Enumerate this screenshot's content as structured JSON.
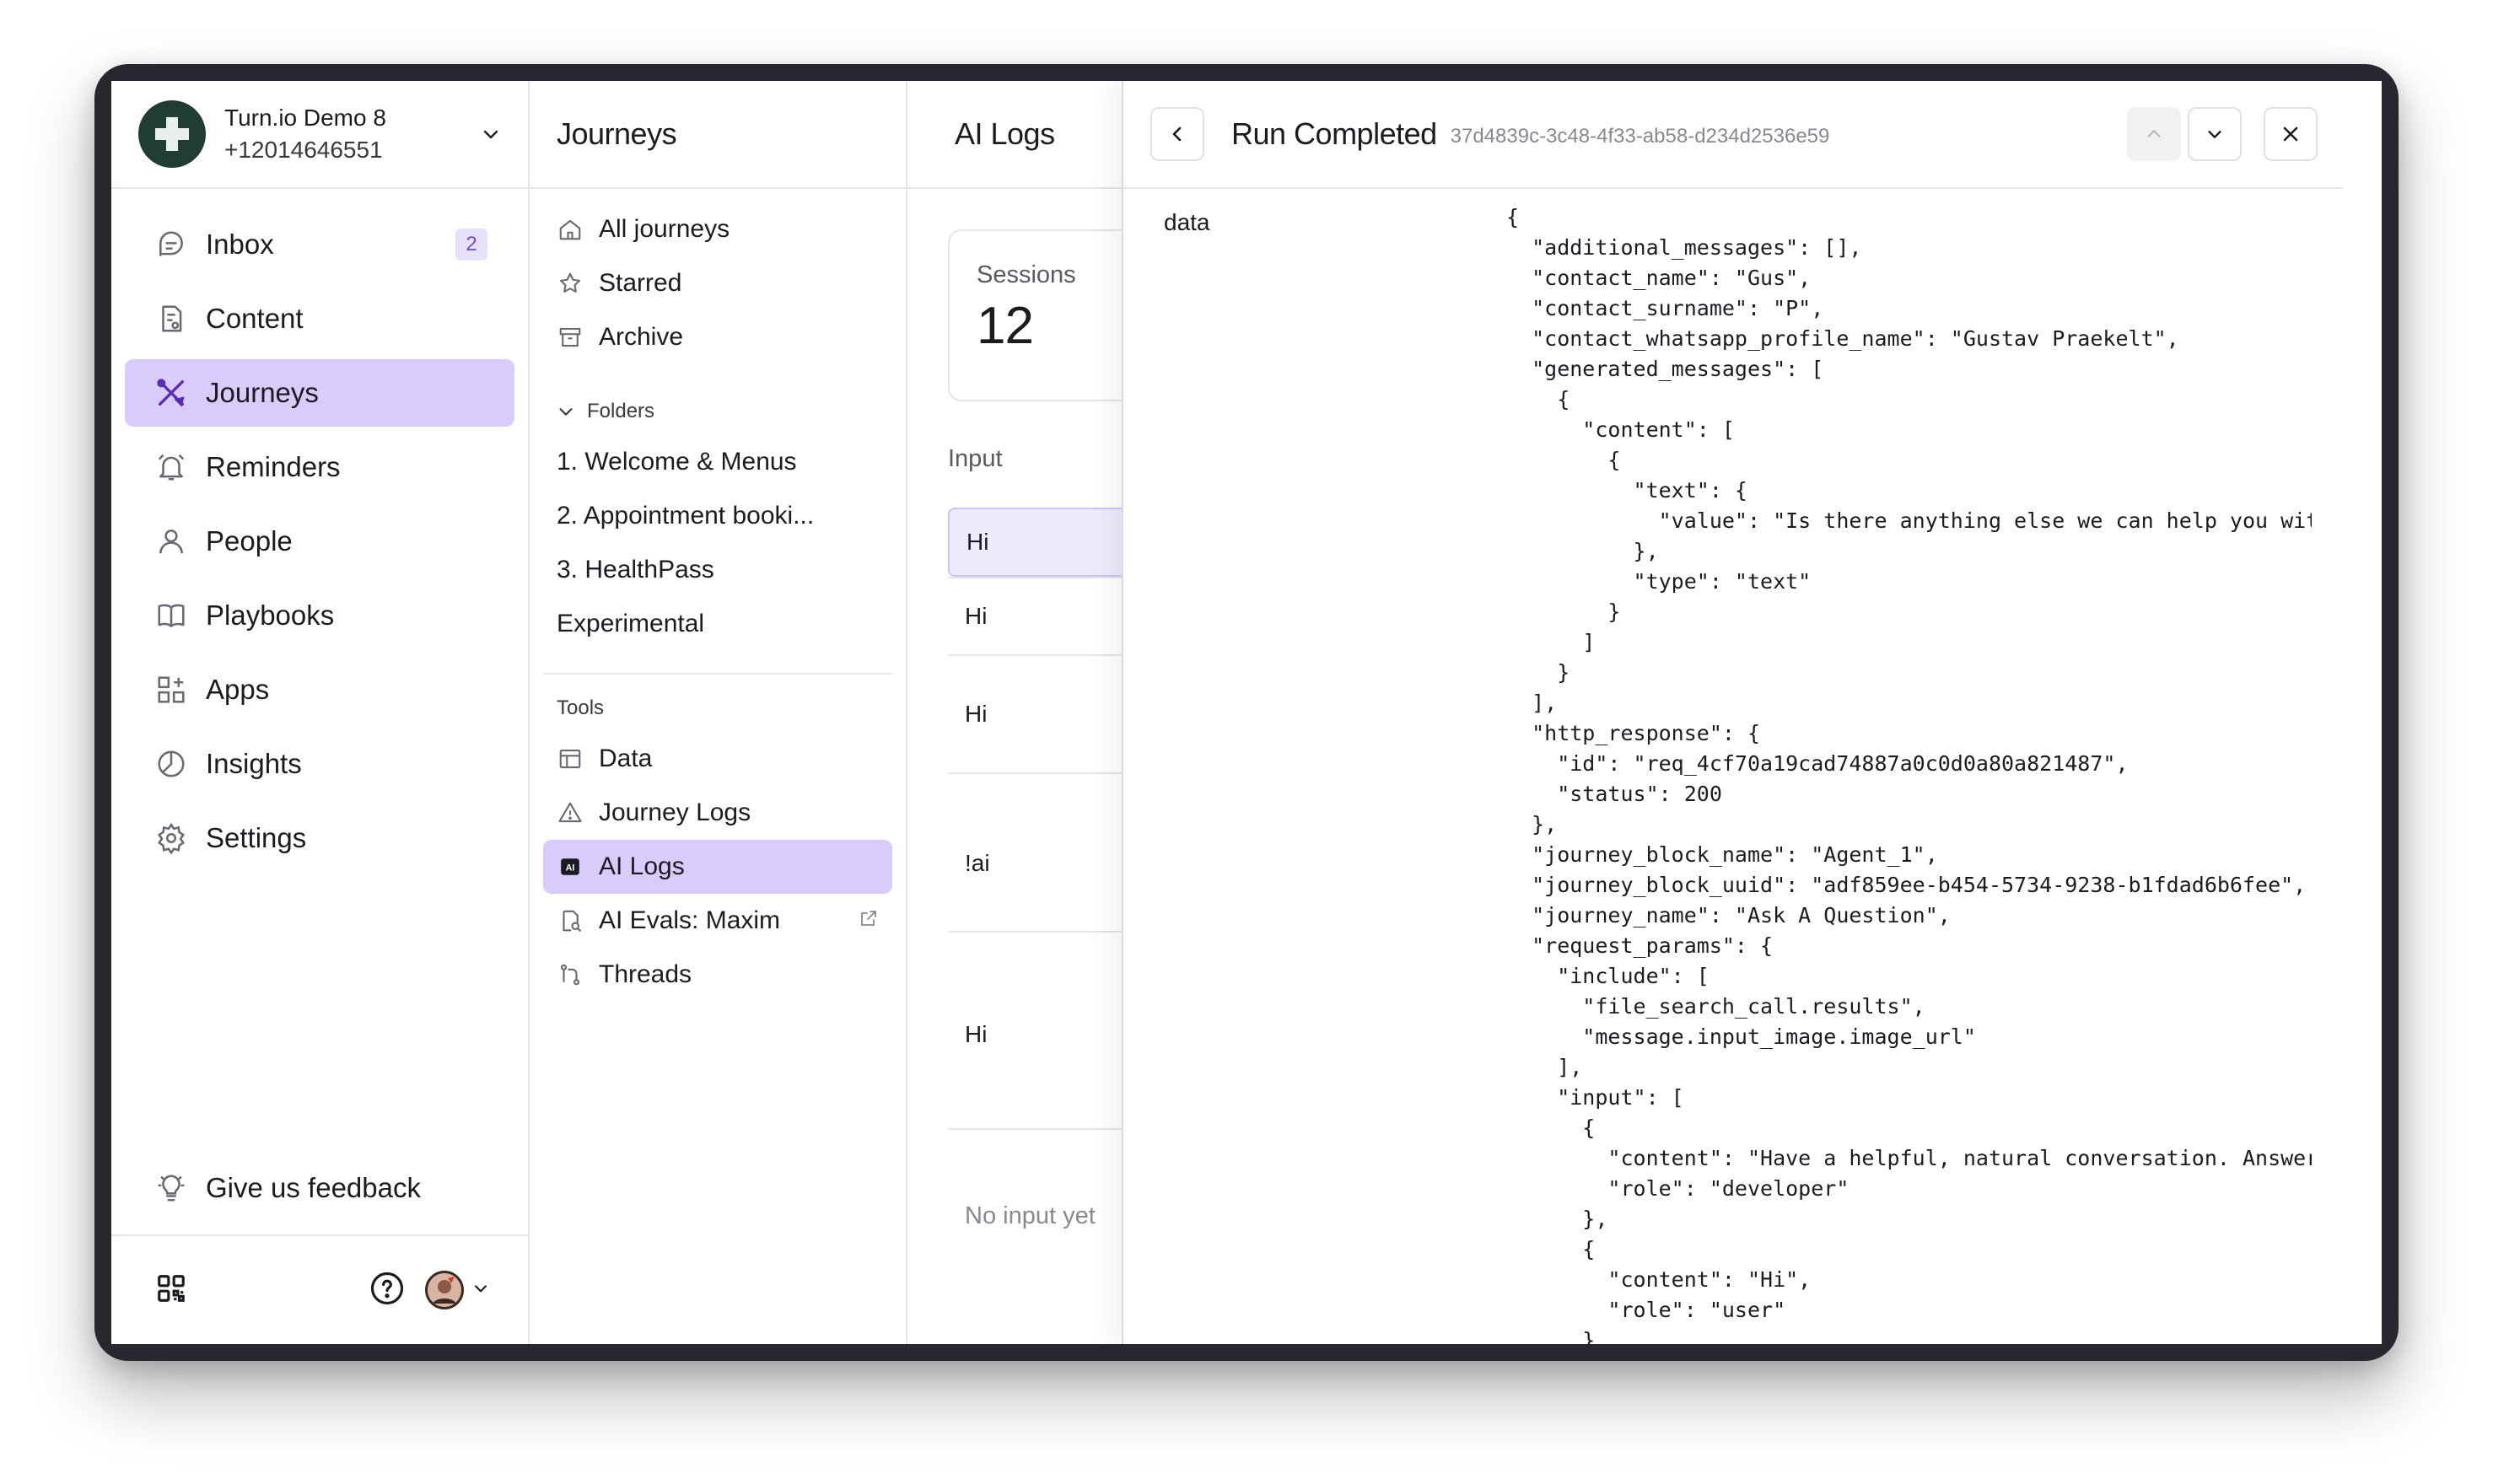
{
  "workspace": {
    "name": "Turn.io Demo 8",
    "phone": "+12014646551"
  },
  "nav": {
    "items": [
      {
        "label": "Inbox",
        "badge": "2"
      },
      {
        "label": "Content"
      },
      {
        "label": "Journeys"
      },
      {
        "label": "Reminders"
      },
      {
        "label": "People"
      },
      {
        "label": "Playbooks"
      },
      {
        "label": "Apps"
      },
      {
        "label": "Insights"
      },
      {
        "label": "Settings"
      }
    ],
    "feedback": "Give us feedback"
  },
  "journeys": {
    "title": "Journeys",
    "items": [
      "All journeys",
      "Starred",
      "Archive"
    ],
    "folders_label": "Folders",
    "folders": [
      "1. Welcome & Menus",
      "2. Appointment booki...",
      "3. HealthPass",
      "Experimental"
    ],
    "tools_label": "Tools",
    "tools": [
      "Data",
      "Journey Logs",
      "AI Logs",
      "AI Evals: Maxim",
      "Threads"
    ]
  },
  "ailogs": {
    "title": "AI Logs",
    "sessions_label": "Sessions",
    "sessions_value": "12",
    "input_header": "Input",
    "rows": [
      "Hi",
      "Hi",
      "Hi",
      "!ai",
      "Hi"
    ],
    "empty": "No input yet"
  },
  "detail": {
    "title": "Run Completed",
    "run_id": "37d4839c-3c48-4f33-ab58-d234d2536e59",
    "data_label": "data",
    "json_lines": [
      "{",
      "  \"additional_messages\": [],",
      "  \"contact_name\": \"Gus\",",
      "  \"contact_surname\": \"P\",",
      "  \"contact_whatsapp_profile_name\": \"Gustav Praekelt\",",
      "  \"generated_messages\": [",
      "    {",
      "      \"content\": [",
      "        {",
      "          \"text\": {",
      "            \"value\": \"Is there anything else we can help you with",
      "          },",
      "          \"type\": \"text\"",
      "        }",
      "      ]",
      "    }",
      "  ],",
      "  \"http_response\": {",
      "    \"id\": \"req_4cf70a19cad74887a0c0d0a80a821487\",",
      "    \"status\": 200",
      "  },",
      "  \"journey_block_name\": \"Agent_1\",",
      "  \"journey_block_uuid\": \"adf859ee-b454-5734-9238-b1fdad6b6fee\",",
      "  \"journey_name\": \"Ask A Question\",",
      "  \"request_params\": {",
      "    \"include\": [",
      "      \"file_search_call.results\",",
      "      \"message.input_image.image_url\"",
      "    ],",
      "    \"input\": [",
      "      {",
      "        \"content\": \"Have a helpful, natural conversation. Answer c",
      "        \"role\": \"developer\"",
      "      },",
      "      {",
      "        \"content\": \"Hi\",",
      "        \"role\": \"user\"",
      "      }"
    ]
  },
  "colors": {
    "accent": "#d9ccfa",
    "accent_icon": "#5b2bb5",
    "border": "#e6e4ea",
    "bezel": "#2a2630"
  }
}
